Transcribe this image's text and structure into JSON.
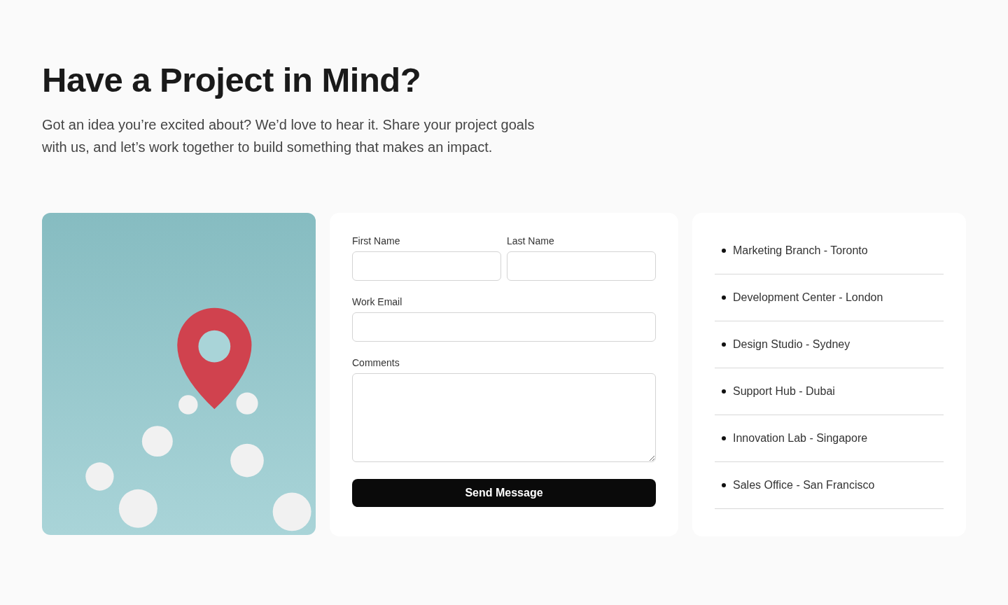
{
  "heading": "Have a Project in Mind?",
  "intro": "Got an idea you’re excited about? We’d love to hear it. Share your project goals with us, and let’s work together to build something that makes an impact.",
  "form": {
    "rows": [
      {
        "fields": [
          {
            "kind": "input",
            "label": "First Name"
          },
          {
            "kind": "input",
            "label": "Last Name"
          }
        ]
      },
      {
        "fields": [
          {
            "kind": "input",
            "label": "Work Email"
          }
        ]
      },
      {
        "fields": [
          {
            "kind": "textarea",
            "label": "Comments"
          }
        ]
      }
    ],
    "submit": "Send Message"
  },
  "locations": [
    "Marketing Branch - Toronto",
    "Development Center - London",
    "Design Studio - Sydney",
    "Support Hub - Dubai",
    "Innovation Lab - Singapore",
    "Sales Office - San Francisco"
  ]
}
